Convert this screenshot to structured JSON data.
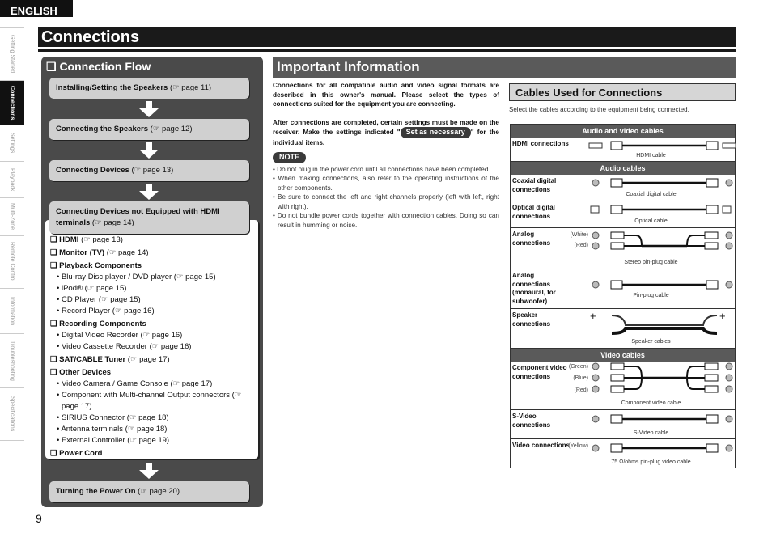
{
  "language_tab": "ENGLISH",
  "side_tabs": [
    "Getting Started",
    "Connections",
    "Settings",
    "Playback",
    "Multi-Zone",
    "Remote Control",
    "Information",
    "Troubleshooting",
    "Specifications"
  ],
  "page_title": "Connections",
  "page_number": "9",
  "flow": {
    "heading": "❑ Connection Flow",
    "steps": [
      {
        "label": "Installing/Setting the Speakers",
        "ref": "(☞ page 11)"
      },
      {
        "label": "Connecting the Speakers",
        "ref": "(☞ page 12)"
      },
      {
        "label": "Connecting Devices",
        "ref": "(☞ page 13)"
      },
      {
        "label": "Connecting Devices not Equipped with HDMI terminals",
        "ref": "(☞ page 14)"
      },
      {
        "label": "Turning the Power On",
        "ref": "(☞ page 20)"
      }
    ],
    "categories": [
      {
        "label": "❑ HDMI",
        "ref": "(☞ page 13)",
        "items": []
      },
      {
        "label": "❑ Monitor (TV)",
        "ref": "(☞ page 14)",
        "items": []
      },
      {
        "label": "❑ Playback Components",
        "ref": "",
        "items": [
          "• Blu-ray Disc player / DVD player (☞ page 15)",
          "• iPod® (☞ page 15)",
          "• CD Player (☞ page 15)",
          "• Record Player (☞ page 16)"
        ]
      },
      {
        "label": "❑ Recording Components",
        "ref": "",
        "items": [
          "• Digital Video Recorder (☞ page 16)",
          "• Video Cassette Recorder (☞ page 16)"
        ]
      },
      {
        "label": "❑ SAT/CABLE Tuner",
        "ref": "(☞ page 17)",
        "items": []
      },
      {
        "label": "❑ Other Devices",
        "ref": "",
        "items": [
          "• Video Camera / Game Console (☞ page 17)",
          "• Component with Multi-channel Output connectors (☞ page 17)",
          "• SIRIUS Connector (☞ page 18)",
          "• Antenna terminals (☞ page 18)",
          "• External Controller (☞ page 19)"
        ]
      },
      {
        "label": "❑ Power Cord",
        "ref": "",
        "items": []
      }
    ]
  },
  "important": {
    "heading": "Important Information",
    "para1": "Connections for all compatible audio and video signal formats are described in this owner's manual. Please select the types of connections suited for the equipment you are connecting.",
    "para2_pre": "After connections are completed, certain settings must be made on the receiver. Make the settings indicated \"",
    "pill": "Set as necessary",
    "para2_post": "\" for the individual items.",
    "note_label": "NOTE",
    "notes": [
      "Do not plug in the power cord until all connections have been completed.",
      "When making connections, also refer to the operating instructions of the other components.",
      "Be sure to connect the left and right channels properly (left with left, right with right).",
      "Do not bundle power cords together with connection cables. Doing so can result in humming or noise."
    ]
  },
  "cables": {
    "heading": "Cables Used for Connections",
    "caption": "Select the cables according to the equipment being connected.",
    "sections": [
      "Audio and video cables",
      "Audio cables",
      "Video cables"
    ],
    "rows": {
      "hdmi": {
        "label": "HDMI connections",
        "cable": "HDMI cable"
      },
      "coax": {
        "label": "Coaxial digital connections",
        "cable": "Coaxial digital cable"
      },
      "optical": {
        "label": "Optical digital connections",
        "cable": "Optical cable"
      },
      "analog": {
        "label": "Analog connections",
        "cable": "Stereo pin-plug cable",
        "colors": [
          "(White)",
          "(Red)"
        ]
      },
      "mono": {
        "label": "Analog connections (monaural, for subwoofer)",
        "cable": "Pin-plug cable"
      },
      "speaker": {
        "label": "Speaker connections",
        "cable": "Speaker cables",
        "plus": "+",
        "minus": "–"
      },
      "component": {
        "label": "Component video connections",
        "cable": "Component video cable",
        "colors": [
          "(Green)",
          "(Blue)",
          "(Red)"
        ]
      },
      "svideo": {
        "label": "S-Video connections",
        "cable": "S-Video cable"
      },
      "video": {
        "label": "Video connections",
        "cable": "75 Ω/ohms pin-plug video cable",
        "colors": [
          "(Yellow)"
        ]
      }
    }
  }
}
